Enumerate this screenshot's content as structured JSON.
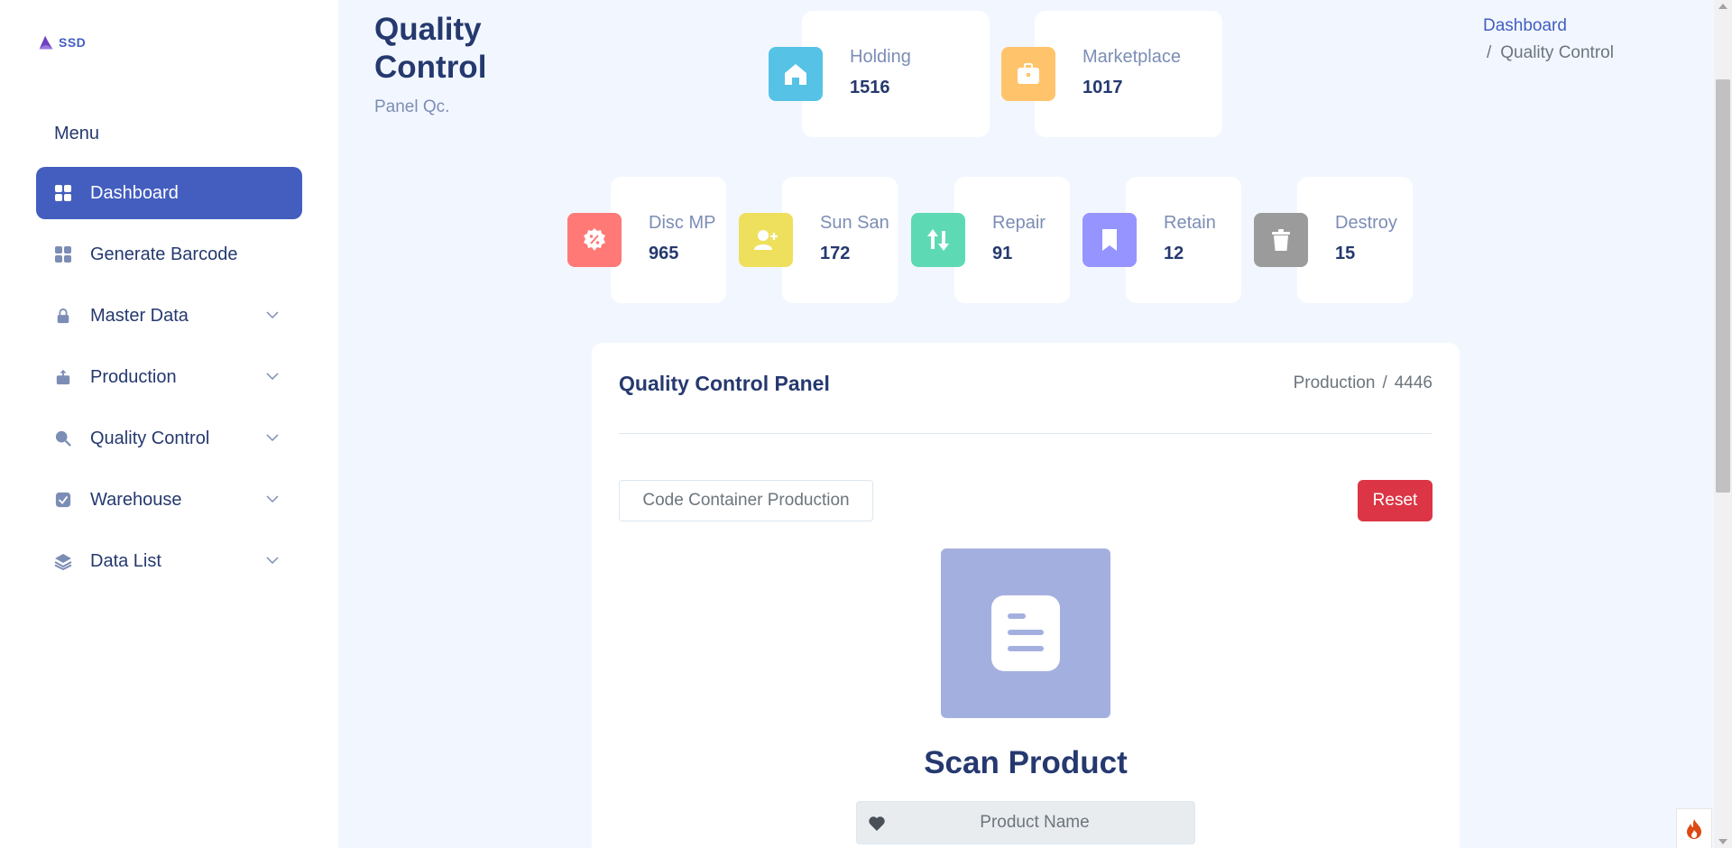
{
  "app": {
    "logo_text": "SSD"
  },
  "sidebar": {
    "menu_title": "Menu",
    "items": [
      {
        "label": "Dashboard",
        "icon": "grid-icon",
        "active": true
      },
      {
        "label": "Generate Barcode",
        "icon": "grid-icon"
      },
      {
        "label": "Master Data",
        "icon": "lock-icon",
        "has_submenu": true
      },
      {
        "label": "Production",
        "icon": "box-upload-icon",
        "has_submenu": true
      },
      {
        "label": "Quality Control",
        "icon": "search-icon",
        "has_submenu": true
      },
      {
        "label": "Warehouse",
        "icon": "check-square-icon",
        "has_submenu": true
      },
      {
        "label": "Data List",
        "icon": "stack-icon",
        "has_submenu": true
      }
    ]
  },
  "header": {
    "title": "Quality Control",
    "subtitle": "Panel Qc.",
    "breadcrumb": {
      "home": "Dashboard",
      "separator": "/",
      "current": "Quality Control"
    }
  },
  "stats_top": [
    {
      "label": "Holding",
      "value": "1516",
      "icon": "house-icon",
      "color": "#56c2e6"
    },
    {
      "label": "Marketplace",
      "value": "1017",
      "icon": "briefcase-icon",
      "color": "#ffc46b"
    }
  ],
  "stats_bottom": [
    {
      "label": "Disc MP",
      "value": "965",
      "icon": "discount-badge-icon",
      "color": "#ff7976"
    },
    {
      "label": "Sun San",
      "value": "172",
      "icon": "person-add-icon",
      "color": "#eee05c"
    },
    {
      "label": "Repair",
      "value": "91",
      "icon": "arrows-updown-icon",
      "color": "#57caeb"
    },
    {
      "label": "Retain",
      "value": "12",
      "icon": "bookmark-icon",
      "color": "#9694ff"
    },
    {
      "label": "Destroy",
      "value": "15",
      "icon": "trash-icon",
      "color": "#9b9b9b"
    }
  ],
  "panel": {
    "title": "Quality Control Panel",
    "crumb_left": "Production",
    "crumb_sep": "/",
    "crumb_right": "4446",
    "code_button": "Code Container Production",
    "reset_button": "Reset",
    "scan_title": "Scan Product",
    "product_placeholder": "Product Name"
  },
  "colors": {
    "primary": "#435ebe",
    "danger": "#dc3545",
    "background": "#f2f7ff",
    "text": "#25396f",
    "scan_box": "#a3b0df"
  }
}
